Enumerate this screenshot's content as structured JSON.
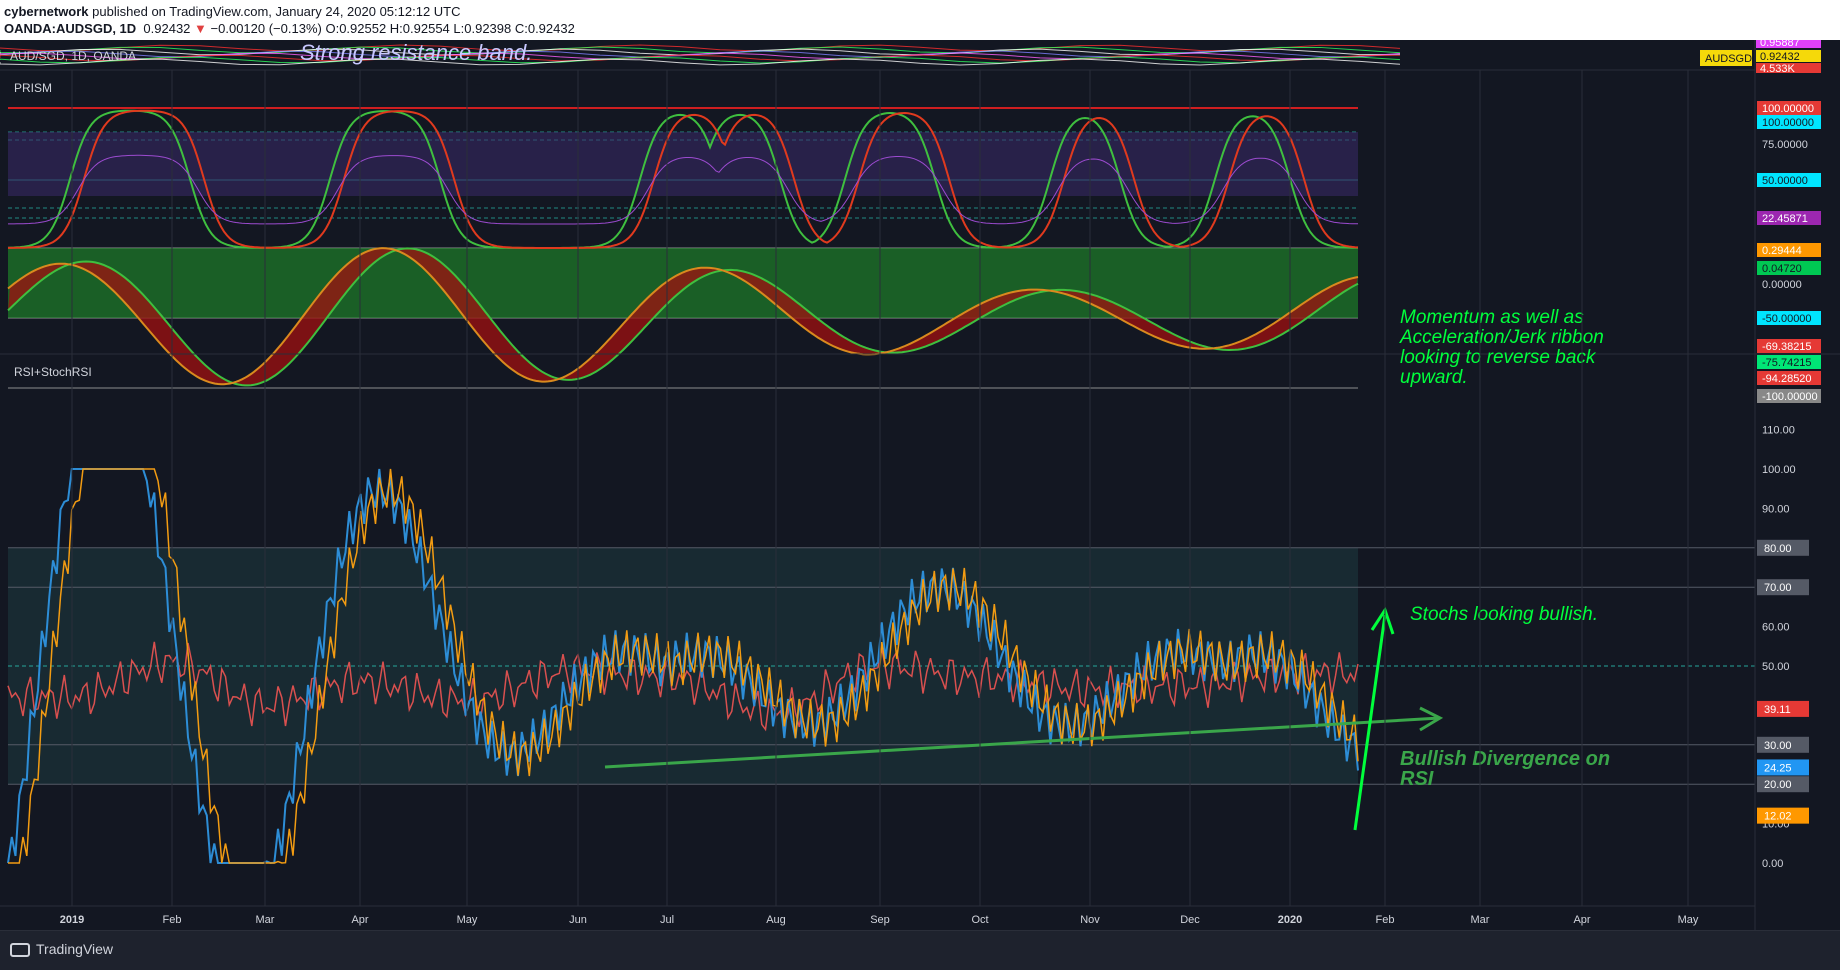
{
  "header": {
    "author": "cybernetwork",
    "published": "published on TradingView.com, January 24, 2020 05:12:12 UTC",
    "symbol": "OANDA:AUDSGD, 1D",
    "price": "0.92432",
    "change": "−0.00120 (−0.13%)",
    "ohlc": "O:0.92552 H:0.92554 L:0.92398 C:0.92432"
  },
  "top_pane": {
    "symbol_label": "AUD/SGD, 1D, OANDA",
    "annotation": "Strong resistance band.",
    "scale_values": [
      "0.95887",
      "0.92432",
      "4.533K"
    ],
    "symbol_tag": "AUDSGD"
  },
  "prism": {
    "title": "PRISM",
    "scale_labels": [
      "100.00000",
      "100.00000",
      "75.00000",
      "50.00000",
      "22.45871"
    ],
    "scale_labels2": [
      "0.29444",
      "0.04720",
      "0.00000",
      "-50.00000",
      "-69.38215",
      "-75.74215",
      "-94.28520",
      "-100.00000"
    ],
    "annotation": [
      "Momentum as well as",
      "Acceleration/Jerk ribbon",
      "looking to reverse back",
      "upward."
    ]
  },
  "rsi": {
    "title": "RSI+StochRSI",
    "scale_ticks": [
      "110.00",
      "100.00",
      "90.00",
      "80.00",
      "70.00",
      "60.00",
      "50.00",
      "40.00",
      "30.00",
      "20.00",
      "10.00",
      "0.00"
    ],
    "badges": [
      "80.00",
      "70.00",
      "39.11",
      "30.00",
      "24.25",
      "20.00",
      "12.02"
    ],
    "annotation_stochs": "Stochs looking bullish.",
    "annotation_divergence": [
      "Bullish Divergence on",
      "RSI"
    ]
  },
  "x_axis": {
    "labels": [
      "2019",
      "Feb",
      "Mar",
      "Apr",
      "May",
      "Jun",
      "Jul",
      "Aug",
      "Sep",
      "Oct",
      "Nov",
      "Dec",
      "2020",
      "Feb",
      "Mar",
      "Apr",
      "May"
    ]
  },
  "footer": {
    "brand": "TradingView"
  },
  "colors": {
    "background": "#131722",
    "stoch_k": "#2d8dd6",
    "stoch_d": "#f39c12",
    "rsi": "#d9504f",
    "annotation_bright": "#00ff3c",
    "annotation_dark": "#3aa64a",
    "bull": "#1f8f2a",
    "bear": "#a01010"
  },
  "chart_data": {
    "type": "line",
    "title": "RSI+StochRSI",
    "ylim": [
      0,
      110
    ],
    "x": [
      "2019",
      "Feb",
      "Mar",
      "Apr",
      "May",
      "Jun",
      "Jul",
      "Aug",
      "Sep",
      "Oct",
      "Nov",
      "Dec",
      "2020"
    ],
    "series": [
      {
        "name": "RSI",
        "values": [
          42,
          51,
          40,
          46,
          41,
          49,
          47,
          38,
          50,
          47,
          44,
          45,
          48
        ]
      },
      {
        "name": "StochRSI K",
        "values": [
          10,
          98,
          5,
          90,
          15,
          95,
          85,
          2,
          100,
          20,
          95,
          60,
          97
        ]
      },
      {
        "name": "StochRSI D",
        "values": [
          8,
          95,
          10,
          86,
          20,
          93,
          88,
          5,
          98,
          25,
          90,
          65,
          95
        ]
      }
    ],
    "last_values": {
      "RSI": 39.11,
      "StochRSI K": 12.02,
      "StochRSI D": 24.25
    },
    "levels": [
      80,
      70,
      50,
      30,
      20
    ]
  }
}
